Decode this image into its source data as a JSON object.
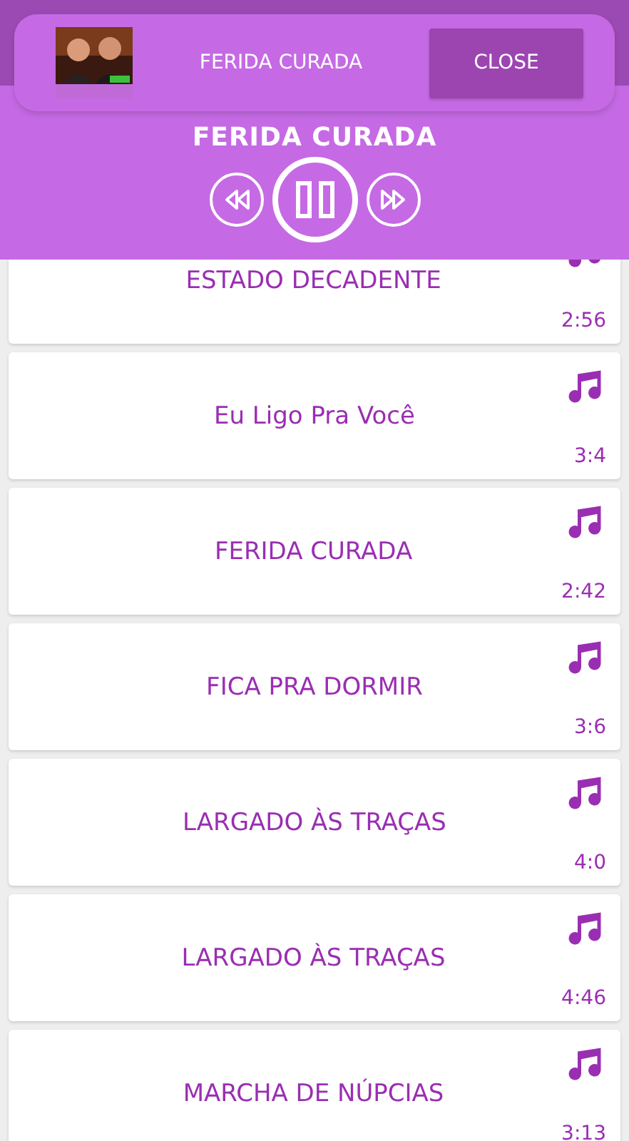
{
  "mini_player": {
    "title": "FERIDA CURADA",
    "close_button": "CLOSE"
  },
  "player": {
    "title": "FERIDA CURADA",
    "playing": true
  },
  "songs": [
    {
      "title": "ESTADO DECADENTE",
      "duration": "2:56"
    },
    {
      "title": "Eu Ligo Pra Você",
      "duration": "3:4"
    },
    {
      "title": "FERIDA CURADA",
      "duration": "2:42"
    },
    {
      "title": "FICA PRA DORMIR",
      "duration": "3:6"
    },
    {
      "title": "LARGADO ÀS TRAÇAS",
      "duration": "4:0"
    },
    {
      "title": "LARGADO ÀS TRAÇAS",
      "duration": "4:46"
    },
    {
      "title": "MARCHA DE NÚPCIAS",
      "duration": "3:13"
    }
  ]
}
